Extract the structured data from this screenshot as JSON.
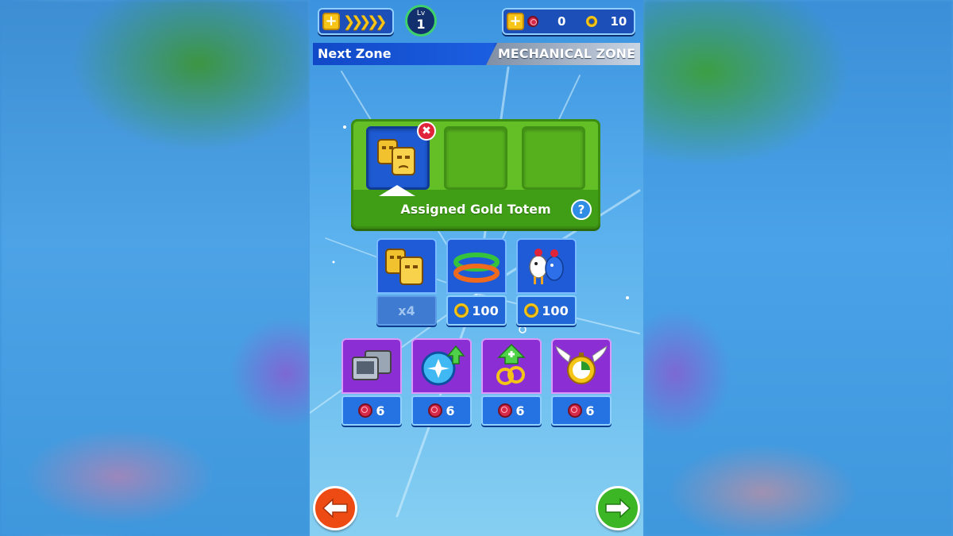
{
  "top_bar": {
    "xp_plus_icon": "plus-icon",
    "level_prefix": "Lv",
    "level_value": "1",
    "red_rings": "0",
    "gold_rings": "10"
  },
  "zone_bar": {
    "left_label": "Next Zone",
    "right_label": "MECHANICAL ZONE"
  },
  "assign_panel": {
    "label": "Assigned Gold Totem",
    "help": "?",
    "remove": "✖"
  },
  "items": [
    {
      "name": "gold-totem",
      "price": "x4",
      "dimmed": true
    },
    {
      "name": "rings",
      "price": "100",
      "currency": "gold-ring"
    },
    {
      "name": "animal-friends",
      "price": "100",
      "currency": "gold-ring"
    }
  ],
  "powerups": [
    {
      "name": "monitors",
      "price": "6",
      "currency": "red-ring"
    },
    {
      "name": "blue-orb",
      "price": "6",
      "currency": "red-ring"
    },
    {
      "name": "ring-boost",
      "price": "6",
      "currency": "red-ring"
    },
    {
      "name": "winged-stopwatch",
      "price": "6",
      "currency": "red-ring"
    }
  ],
  "colors": {
    "accent_blue": "#1d4fb8",
    "panel_green": "#63bf25",
    "powerup_purple": "#8b2fd5",
    "back_button": "#ee4a14",
    "next_button": "#3cb624"
  }
}
